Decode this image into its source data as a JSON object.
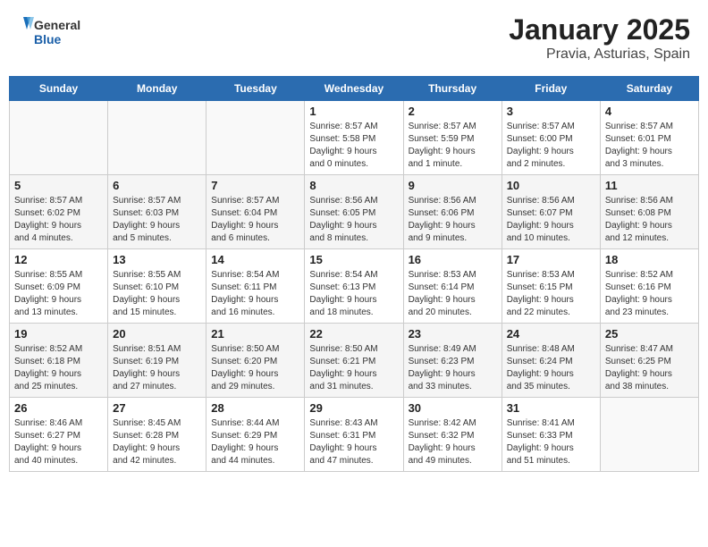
{
  "header": {
    "logo_general": "General",
    "logo_blue": "Blue",
    "title": "January 2025",
    "subtitle": "Pravia, Asturias, Spain"
  },
  "weekdays": [
    "Sunday",
    "Monday",
    "Tuesday",
    "Wednesday",
    "Thursday",
    "Friday",
    "Saturday"
  ],
  "weeks": [
    {
      "days": [
        {
          "num": "",
          "info": ""
        },
        {
          "num": "",
          "info": ""
        },
        {
          "num": "",
          "info": ""
        },
        {
          "num": "1",
          "info": "Sunrise: 8:57 AM\nSunset: 5:58 PM\nDaylight: 9 hours\nand 0 minutes."
        },
        {
          "num": "2",
          "info": "Sunrise: 8:57 AM\nSunset: 5:59 PM\nDaylight: 9 hours\nand 1 minute."
        },
        {
          "num": "3",
          "info": "Sunrise: 8:57 AM\nSunset: 6:00 PM\nDaylight: 9 hours\nand 2 minutes."
        },
        {
          "num": "4",
          "info": "Sunrise: 8:57 AM\nSunset: 6:01 PM\nDaylight: 9 hours\nand 3 minutes."
        }
      ]
    },
    {
      "days": [
        {
          "num": "5",
          "info": "Sunrise: 8:57 AM\nSunset: 6:02 PM\nDaylight: 9 hours\nand 4 minutes."
        },
        {
          "num": "6",
          "info": "Sunrise: 8:57 AM\nSunset: 6:03 PM\nDaylight: 9 hours\nand 5 minutes."
        },
        {
          "num": "7",
          "info": "Sunrise: 8:57 AM\nSunset: 6:04 PM\nDaylight: 9 hours\nand 6 minutes."
        },
        {
          "num": "8",
          "info": "Sunrise: 8:56 AM\nSunset: 6:05 PM\nDaylight: 9 hours\nand 8 minutes."
        },
        {
          "num": "9",
          "info": "Sunrise: 8:56 AM\nSunset: 6:06 PM\nDaylight: 9 hours\nand 9 minutes."
        },
        {
          "num": "10",
          "info": "Sunrise: 8:56 AM\nSunset: 6:07 PM\nDaylight: 9 hours\nand 10 minutes."
        },
        {
          "num": "11",
          "info": "Sunrise: 8:56 AM\nSunset: 6:08 PM\nDaylight: 9 hours\nand 12 minutes."
        }
      ]
    },
    {
      "days": [
        {
          "num": "12",
          "info": "Sunrise: 8:55 AM\nSunset: 6:09 PM\nDaylight: 9 hours\nand 13 minutes."
        },
        {
          "num": "13",
          "info": "Sunrise: 8:55 AM\nSunset: 6:10 PM\nDaylight: 9 hours\nand 15 minutes."
        },
        {
          "num": "14",
          "info": "Sunrise: 8:54 AM\nSunset: 6:11 PM\nDaylight: 9 hours\nand 16 minutes."
        },
        {
          "num": "15",
          "info": "Sunrise: 8:54 AM\nSunset: 6:13 PM\nDaylight: 9 hours\nand 18 minutes."
        },
        {
          "num": "16",
          "info": "Sunrise: 8:53 AM\nSunset: 6:14 PM\nDaylight: 9 hours\nand 20 minutes."
        },
        {
          "num": "17",
          "info": "Sunrise: 8:53 AM\nSunset: 6:15 PM\nDaylight: 9 hours\nand 22 minutes."
        },
        {
          "num": "18",
          "info": "Sunrise: 8:52 AM\nSunset: 6:16 PM\nDaylight: 9 hours\nand 23 minutes."
        }
      ]
    },
    {
      "days": [
        {
          "num": "19",
          "info": "Sunrise: 8:52 AM\nSunset: 6:18 PM\nDaylight: 9 hours\nand 25 minutes."
        },
        {
          "num": "20",
          "info": "Sunrise: 8:51 AM\nSunset: 6:19 PM\nDaylight: 9 hours\nand 27 minutes."
        },
        {
          "num": "21",
          "info": "Sunrise: 8:50 AM\nSunset: 6:20 PM\nDaylight: 9 hours\nand 29 minutes."
        },
        {
          "num": "22",
          "info": "Sunrise: 8:50 AM\nSunset: 6:21 PM\nDaylight: 9 hours\nand 31 minutes."
        },
        {
          "num": "23",
          "info": "Sunrise: 8:49 AM\nSunset: 6:23 PM\nDaylight: 9 hours\nand 33 minutes."
        },
        {
          "num": "24",
          "info": "Sunrise: 8:48 AM\nSunset: 6:24 PM\nDaylight: 9 hours\nand 35 minutes."
        },
        {
          "num": "25",
          "info": "Sunrise: 8:47 AM\nSunset: 6:25 PM\nDaylight: 9 hours\nand 38 minutes."
        }
      ]
    },
    {
      "days": [
        {
          "num": "26",
          "info": "Sunrise: 8:46 AM\nSunset: 6:27 PM\nDaylight: 9 hours\nand 40 minutes."
        },
        {
          "num": "27",
          "info": "Sunrise: 8:45 AM\nSunset: 6:28 PM\nDaylight: 9 hours\nand 42 minutes."
        },
        {
          "num": "28",
          "info": "Sunrise: 8:44 AM\nSunset: 6:29 PM\nDaylight: 9 hours\nand 44 minutes."
        },
        {
          "num": "29",
          "info": "Sunrise: 8:43 AM\nSunset: 6:31 PM\nDaylight: 9 hours\nand 47 minutes."
        },
        {
          "num": "30",
          "info": "Sunrise: 8:42 AM\nSunset: 6:32 PM\nDaylight: 9 hours\nand 49 minutes."
        },
        {
          "num": "31",
          "info": "Sunrise: 8:41 AM\nSunset: 6:33 PM\nDaylight: 9 hours\nand 51 minutes."
        },
        {
          "num": "",
          "info": ""
        }
      ]
    }
  ]
}
